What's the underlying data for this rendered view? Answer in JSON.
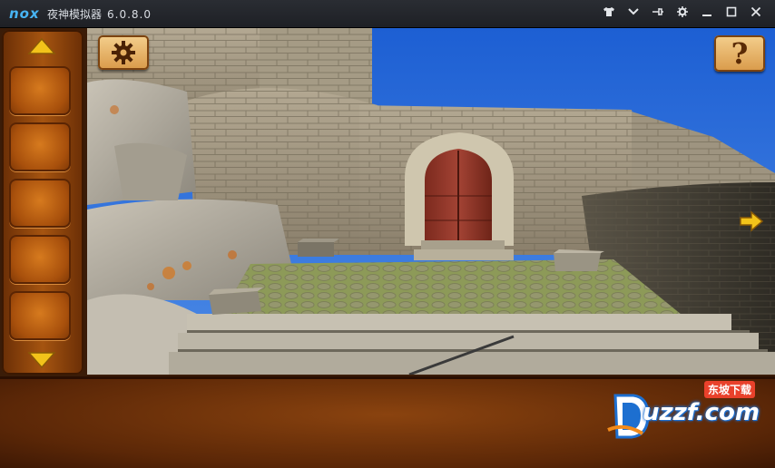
{
  "titlebar": {
    "logo": "nox",
    "title": "夜神模拟器",
    "version": "6.0.8.0",
    "icons": [
      "shirt-icon",
      "chevron-down-icon",
      "pin-icon",
      "gear-icon",
      "minimize-icon",
      "maximize-icon",
      "close-icon"
    ]
  },
  "game": {
    "help_label": "?",
    "inventory_slots": 5
  },
  "watermark": {
    "cn_text": "东坡下载",
    "text": "uzzf.com"
  },
  "colors": {
    "panel_brown": "#5b2707",
    "button_gold": "#e6b062",
    "arrow_yellow": "#f2c31a",
    "sky_blue": "#2f6fd6"
  }
}
